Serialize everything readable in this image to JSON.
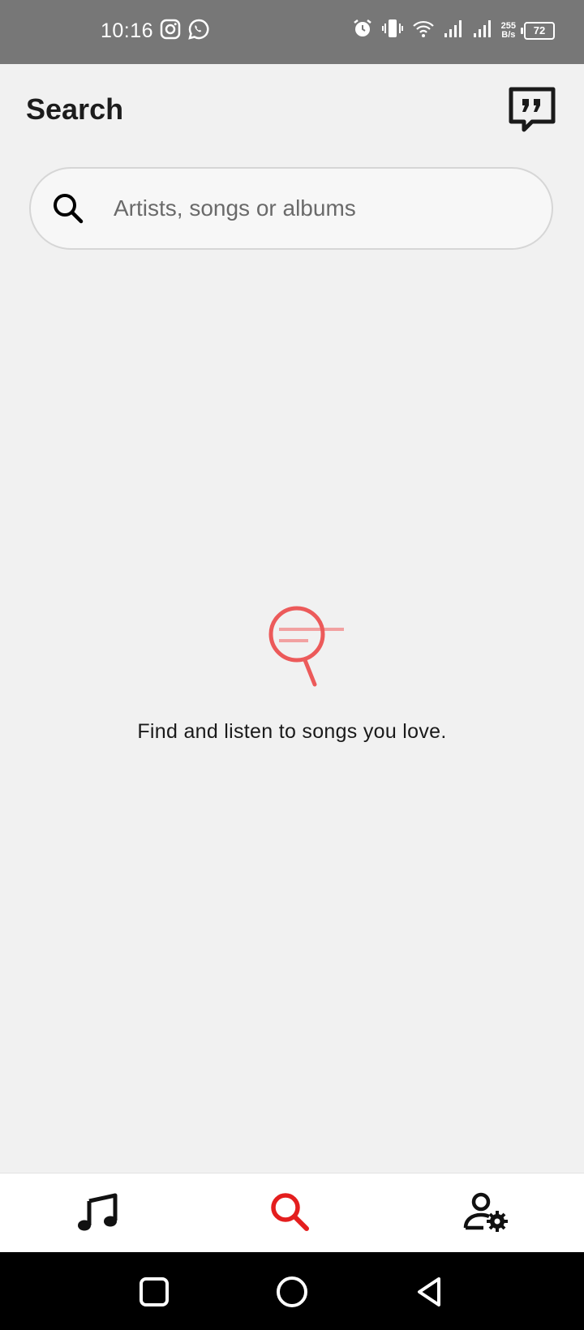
{
  "status_bar": {
    "time": "10:16",
    "net_speed_value": "255",
    "net_speed_unit": "B/s",
    "battery": "72"
  },
  "header": {
    "title": "Search"
  },
  "search": {
    "placeholder": "Artists, songs or albums"
  },
  "empty_state": {
    "message": "Find and listen to songs you love."
  },
  "bottom_nav": {
    "active": "search",
    "active_color": "#e41e1e"
  },
  "colors": {
    "accent": "#e41e1e",
    "illustration": "#ec5a5a"
  }
}
